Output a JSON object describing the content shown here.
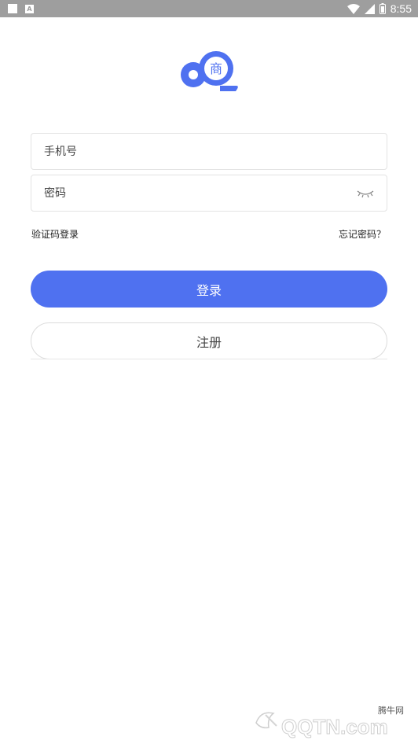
{
  "status_bar": {
    "time": "8:55",
    "icons": [
      "square-icon",
      "a-notification-icon",
      "wifi-icon",
      "signal-icon",
      "battery-icon"
    ],
    "a_glyph": "A"
  },
  "logo": {
    "icon": "shop-logo-icon",
    "glyph": "商",
    "color": "#4f71f0"
  },
  "form": {
    "phone_placeholder": "手机号",
    "password_placeholder": "密码",
    "password_toggle_icon": "eye-closed-icon"
  },
  "links": {
    "sms_login": "验证码登录",
    "forgot_password": "忘记密码？"
  },
  "buttons": {
    "login": "登录",
    "register": "注册"
  },
  "watermark": {
    "cn": "腾牛网",
    "en": "QQTN.com"
  },
  "colors": {
    "accent": "#4f71f0",
    "status_bar": "#9e9e9e"
  }
}
